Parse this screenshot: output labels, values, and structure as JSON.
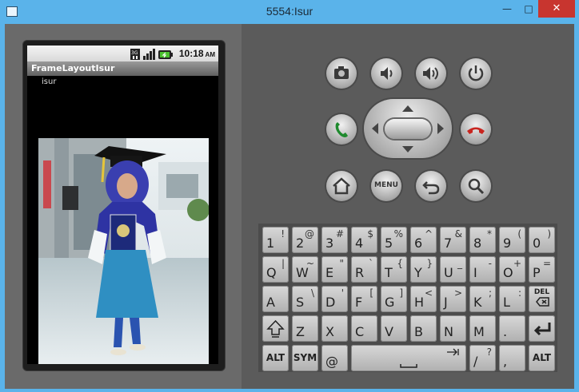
{
  "window": {
    "title": "5554:Isur",
    "minimize": "—",
    "maximize": "□",
    "close": "✕"
  },
  "status_bar": {
    "network": "3G",
    "time": "10:18",
    "ampm": "AM"
  },
  "app": {
    "title": "FrameLayoutIsur",
    "text": "isur"
  },
  "controls": {
    "menu_label": "MENU"
  },
  "keyboard": {
    "row1": [
      {
        "main": "1",
        "alt": "!"
      },
      {
        "main": "2",
        "alt": "@"
      },
      {
        "main": "3",
        "alt": "#"
      },
      {
        "main": "4",
        "alt": "$"
      },
      {
        "main": "5",
        "alt": "%"
      },
      {
        "main": "6",
        "alt": "^"
      },
      {
        "main": "7",
        "alt": "&"
      },
      {
        "main": "8",
        "alt": "*"
      },
      {
        "main": "9",
        "alt": "("
      },
      {
        "main": "0",
        "alt": ")"
      }
    ],
    "row2": [
      {
        "main": "Q",
        "alt": "|"
      },
      {
        "main": "W",
        "alt": "~"
      },
      {
        "main": "E",
        "alt": "\""
      },
      {
        "main": "R",
        "alt": "`"
      },
      {
        "main": "T",
        "alt": "{"
      },
      {
        "main": "Y",
        "alt": "}"
      },
      {
        "main": "U",
        "alt": "_"
      },
      {
        "main": "I",
        "alt": "-"
      },
      {
        "main": "O",
        "alt": "+"
      },
      {
        "main": "P",
        "alt": "="
      }
    ],
    "row3": [
      {
        "main": "A",
        "alt": ""
      },
      {
        "main": "S",
        "alt": "\\"
      },
      {
        "main": "D",
        "alt": "'"
      },
      {
        "main": "F",
        "alt": "["
      },
      {
        "main": "G",
        "alt": "]"
      },
      {
        "main": "H",
        "alt": "<"
      },
      {
        "main": "J",
        "alt": ">"
      },
      {
        "main": "K",
        "alt": ";"
      },
      {
        "main": "L",
        "alt": ":"
      },
      {
        "main": "DEL",
        "alt": ""
      }
    ],
    "row4": [
      {
        "main": "",
        "alt": ""
      },
      {
        "main": "Z",
        "alt": ""
      },
      {
        "main": "X",
        "alt": ""
      },
      {
        "main": "C",
        "alt": ""
      },
      {
        "main": "V",
        "alt": ""
      },
      {
        "main": "B",
        "alt": ""
      },
      {
        "main": "N",
        "alt": ""
      },
      {
        "main": "M",
        "alt": ""
      },
      {
        "main": ".",
        "alt": ""
      },
      {
        "main": "",
        "alt": ""
      }
    ],
    "row5": {
      "alt_left": "ALT",
      "sym": "SYM",
      "at": "@",
      "slash": "/",
      "slash_alt": "?",
      "comma": ",",
      "alt_right": "ALT"
    }
  }
}
